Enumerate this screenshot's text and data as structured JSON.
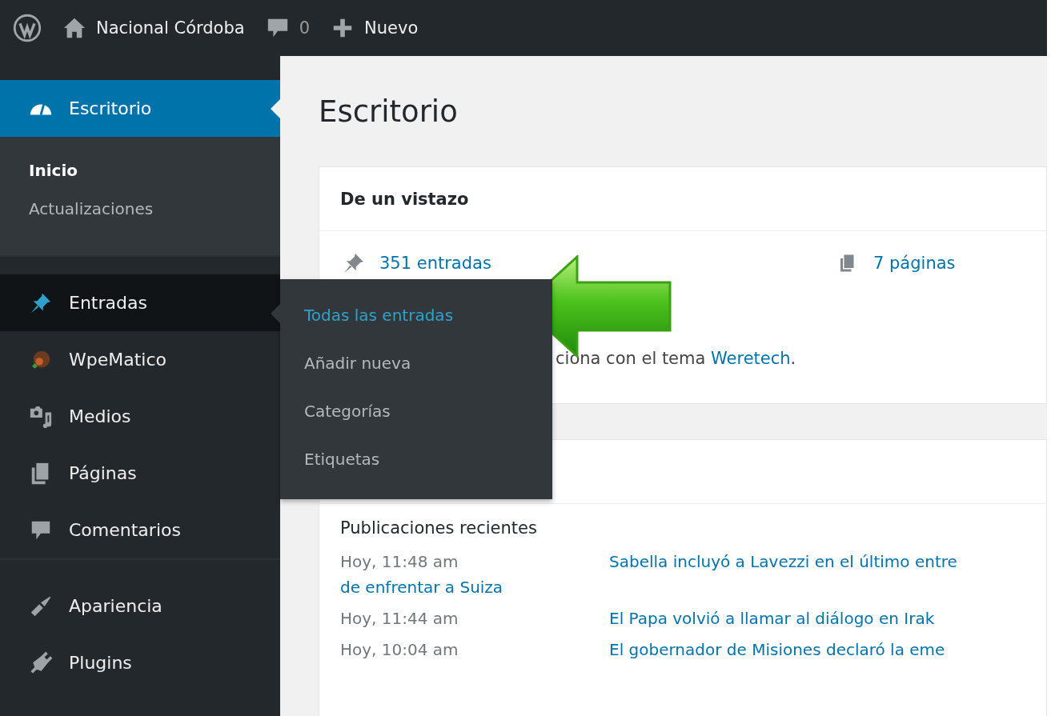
{
  "toolbar": {
    "site_name": "Nacional Córdoba",
    "comments_count": "0",
    "new_label": "Nuevo"
  },
  "sidebar": {
    "groups": [
      {
        "items": [
          {
            "label": "Escritorio",
            "kind": "dashboard",
            "selected": true,
            "highlighted": false,
            "children": [
              {
                "label": "Inicio",
                "selected": true
              },
              {
                "label": "Actualizaciones",
                "selected": false
              }
            ]
          }
        ]
      },
      {
        "items": [
          {
            "label": "Entradas",
            "kind": "pin",
            "selected": false,
            "highlighted": true,
            "flyout": [
              {
                "label": "Todas las entradas",
                "selected": true
              },
              {
                "label": "Añadir nueva",
                "selected": false
              },
              {
                "label": "Categorías",
                "selected": false
              },
              {
                "label": "Etiquetas",
                "selected": false
              }
            ]
          },
          {
            "label": "WpeMatico",
            "kind": "feed",
            "selected": false,
            "highlighted": false
          },
          {
            "label": "Medios",
            "kind": "media",
            "selected": false,
            "highlighted": false
          },
          {
            "label": "Páginas",
            "kind": "pages",
            "selected": false,
            "highlighted": false
          },
          {
            "label": "Comentarios",
            "kind": "comment",
            "selected": false,
            "highlighted": false
          }
        ]
      },
      {
        "items": [
          {
            "label": "Apariencia",
            "kind": "brush",
            "selected": false,
            "highlighted": false
          },
          {
            "label": "Plugins",
            "kind": "plug",
            "selected": false,
            "highlighted": false
          }
        ]
      }
    ]
  },
  "page_title": "Escritorio",
  "glance": {
    "title": "De un vistazo",
    "posts": "351 entradas",
    "pages": "7 páginas",
    "theme_text": "ciona con el tema ",
    "theme_link": "Weretech",
    "theme_suffix": "."
  },
  "activity": {
    "section_title": "Publicaciones recientes",
    "posts": [
      {
        "date": "Hoy, 11:48 am",
        "title": "Sabella incluyó a Lavezzi en el último entre",
        "title_line_2": "de enfrentar a Suiza"
      },
      {
        "date": "Hoy, 11:44 am",
        "title": "El Papa volvió a llamar al diálogo en Irak"
      },
      {
        "date": "Hoy, 10:04 am",
        "title": "El gobernador de Misiones declaró la eme"
      }
    ]
  }
}
